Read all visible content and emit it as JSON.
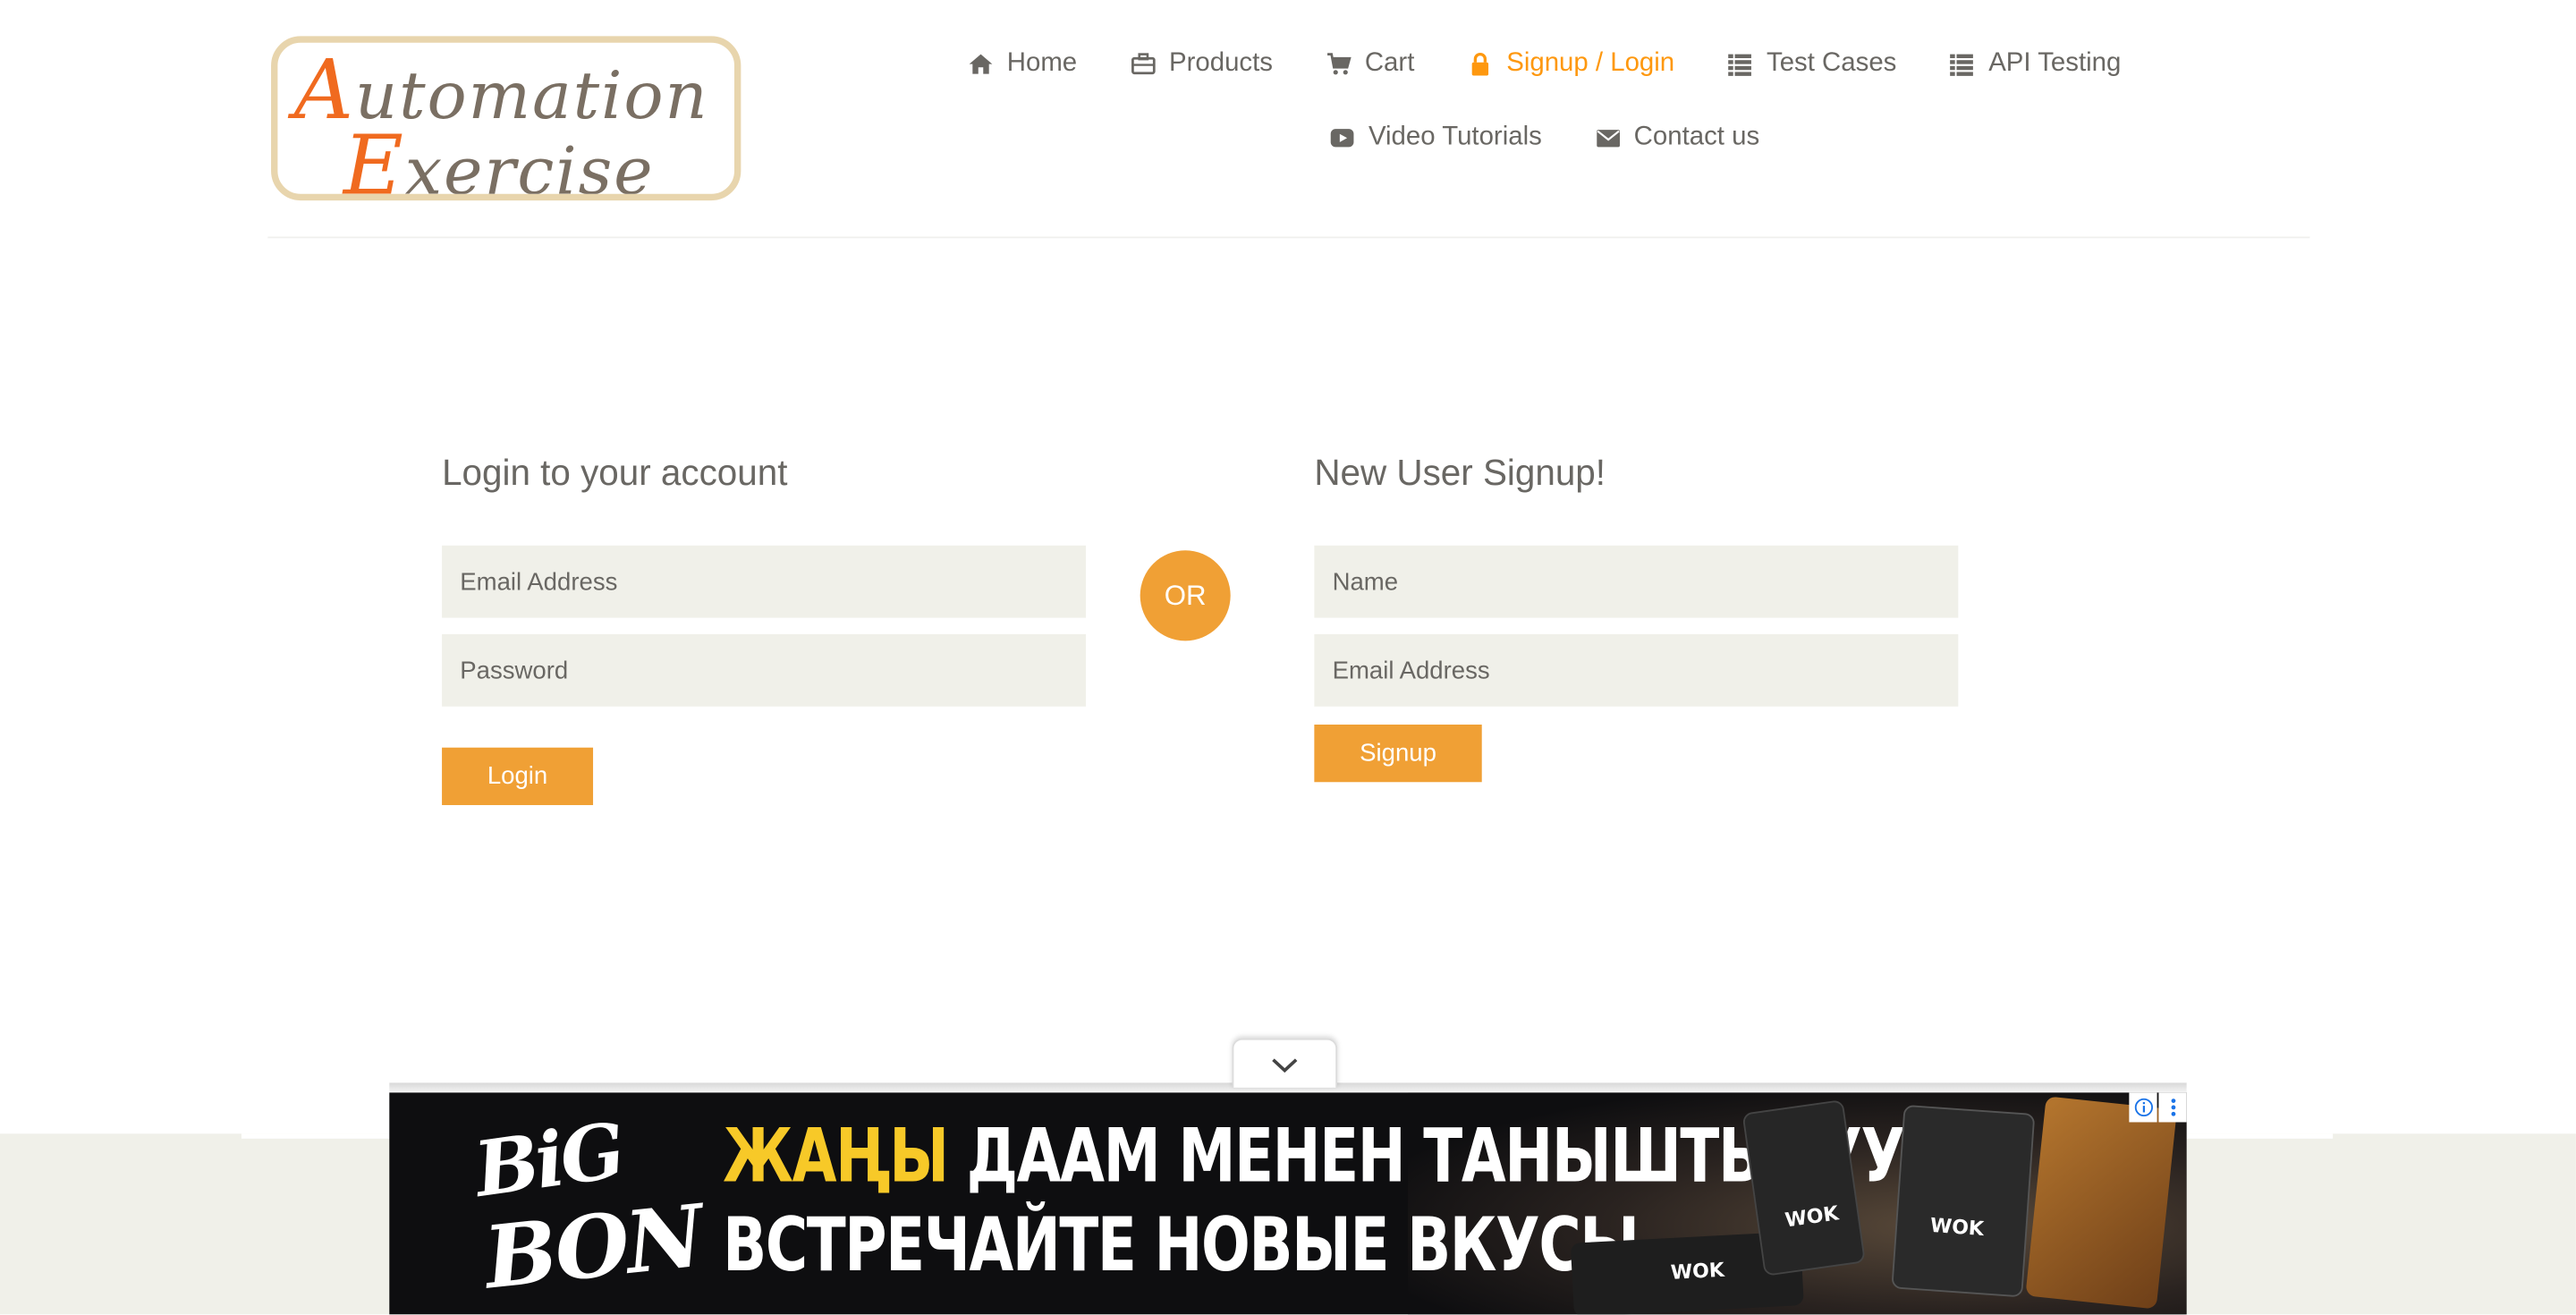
{
  "logo": {
    "line1_cap": "A",
    "line1_rest": "utomation",
    "line2_cap": "E",
    "line2_rest": "xercise"
  },
  "nav": {
    "items": [
      {
        "label": "Home",
        "icon": "home-icon",
        "active": false
      },
      {
        "label": "Products",
        "icon": "briefcase-icon",
        "active": false
      },
      {
        "label": "Cart",
        "icon": "cart-icon",
        "active": false
      },
      {
        "label": "Signup / Login",
        "icon": "lock-icon",
        "active": true
      },
      {
        "label": "Test Cases",
        "icon": "list-icon",
        "active": false
      },
      {
        "label": "API Testing",
        "icon": "list-icon",
        "active": false
      },
      {
        "label": "Video Tutorials",
        "icon": "youtube-play-icon",
        "active": false
      },
      {
        "label": "Contact us",
        "icon": "envelope-icon",
        "active": false
      }
    ]
  },
  "login": {
    "title": "Login to your account",
    "email_placeholder": "Email Address",
    "password_placeholder": "Password",
    "button": "Login"
  },
  "or_label": "OR",
  "signup": {
    "title": "New User Signup!",
    "name_placeholder": "Name",
    "email_placeholder": "Email Address",
    "button": "Signup"
  },
  "ad": {
    "brand_top": "BiG",
    "brand_bottom": "BON",
    "line1_highlight": "ЖАҢЫ",
    "line1_rest": " ДААМ МЕНЕН ТАНЫШТЫРУУ",
    "line2": "ВСТРЕЧАЙТЕ НОВЫЕ ВКУСЫ",
    "pack_label": "WOK",
    "info_icon": "info-icon",
    "menu_icon": "more-vertical-icon",
    "collapse_icon": "chevron-down-icon"
  },
  "colors": {
    "accent": "#fe980f",
    "text": "#696763",
    "field_bg": "#f0f0e9"
  }
}
